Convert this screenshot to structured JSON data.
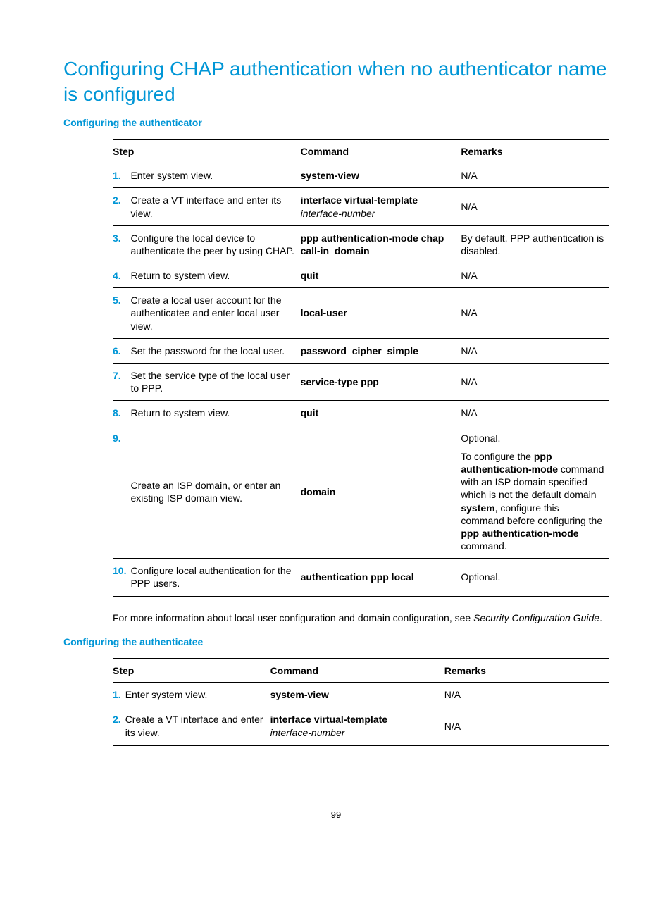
{
  "title": "Configuring CHAP authentication when no authenticator name is configured",
  "section1": {
    "heading": "Configuring the authenticator",
    "headers": {
      "step": "Step",
      "command": "Command",
      "remarks": "Remarks"
    },
    "rows": {
      "r1": {
        "num": "1.",
        "step": "Enter system view.",
        "cmd": "system-view",
        "rem": "N/A"
      },
      "r2": {
        "num": "2.",
        "step": "Create a VT interface and enter its view.",
        "cmd_b": "interface virtual-template",
        "cmd_i": "interface-number",
        "rem": "N/A"
      },
      "r3": {
        "num": "3.",
        "step": "Configure the local device to authenticate the peer by using CHAP.",
        "cmd_b1": "ppp authentication-mode chap",
        "cmd_b2": "call-in",
        "cmd_b3": "domain",
        "rem": "By default, PPP authentication is disabled."
      },
      "r4": {
        "num": "4.",
        "step": "Return to system view.",
        "cmd": "quit",
        "rem": "N/A"
      },
      "r5": {
        "num": "5.",
        "step": "Create a local user account for the authenticatee and enter local user view.",
        "cmd": "local-user",
        "rem": "N/A"
      },
      "r6": {
        "num": "6.",
        "step": "Set the password for the local user.",
        "cmd_b1": "password",
        "cmd_b2": "cipher",
        "cmd_b3": "simple",
        "rem": "N/A"
      },
      "r7": {
        "num": "7.",
        "step": "Set the service type of the local user to PPP.",
        "cmd": "service-type ppp",
        "rem": "N/A"
      },
      "r8": {
        "num": "8.",
        "step": "Return to system view.",
        "cmd": "quit",
        "rem": "N/A"
      },
      "r9": {
        "num": "9.",
        "step": "Create an ISP domain, or enter an existing ISP domain view.",
        "cmd": "domain",
        "rem_p1": "Optional.",
        "rem_p2_a": "To configure the ",
        "rem_p2_b": "ppp authentication-mode",
        "rem_p2_c": " command with an ISP domain specified which is not the default domain ",
        "rem_p2_d": "system",
        "rem_p2_e": ", configure this command before configuring the ",
        "rem_p2_f": "ppp authentication-mode",
        "rem_p2_g": " command."
      },
      "r10": {
        "num": "10.",
        "step": "Configure local authentication for the PPP users.",
        "cmd": "authentication ppp local",
        "rem": "Optional."
      }
    },
    "footnote_a": "For more information about local user configuration and domain configuration, see ",
    "footnote_b": "Security Configuration Guide",
    "footnote_c": "."
  },
  "section2": {
    "heading": "Configuring the authenticatee",
    "headers": {
      "step": "Step",
      "command": "Command",
      "remarks": "Remarks"
    },
    "rows": {
      "r1": {
        "num": "1.",
        "step": "Enter system view.",
        "cmd": "system-view",
        "rem": "N/A"
      },
      "r2": {
        "num": "2.",
        "step": "Create a VT interface and enter its view.",
        "cmd_b": "interface virtual-template",
        "cmd_i": "interface-number",
        "rem": "N/A"
      }
    }
  },
  "page_number": "99"
}
